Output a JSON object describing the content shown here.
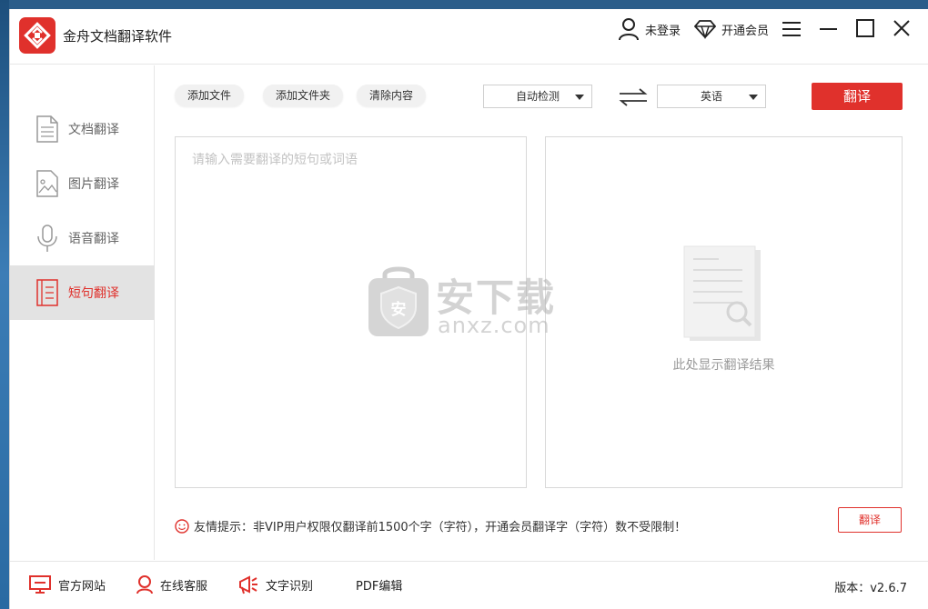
{
  "app": {
    "title": "金舟文档翻译软件"
  },
  "titlebar": {
    "login_label": "未登录",
    "vip_label": "开通会员"
  },
  "sidebar": {
    "items": [
      {
        "label": "文档翻译",
        "icon": "document-icon"
      },
      {
        "label": "图片翻译",
        "icon": "image-icon"
      },
      {
        "label": "语音翻译",
        "icon": "microphone-icon"
      },
      {
        "label": "短句翻译",
        "icon": "sentence-icon",
        "active": true
      }
    ]
  },
  "toolbar": {
    "add_file": "添加文件",
    "add_folder": "添加文件夹",
    "clear": "清除内容",
    "source_lang": "自动检测",
    "target_lang": "英语",
    "translate": "翻译"
  },
  "source": {
    "placeholder": "请输入需要翻译的短句或词语",
    "value": ""
  },
  "result": {
    "empty_text": "此处显示翻译结果"
  },
  "watermark": {
    "text": "安下载",
    "sub": "anxz.com",
    "badge": "安"
  },
  "tip": {
    "text": "友情提示：非VIP用户权限仅翻译前1500个字（字符），开通会员翻译字（字符）数不受限制！"
  },
  "bottom_translate": "翻译",
  "footer": {
    "website": "官方网站",
    "service": "在线客服",
    "ocr": "文字识别",
    "pdf": "PDF编辑",
    "version": "版本：v2.6.7"
  },
  "colors": {
    "accent": "#e0312c",
    "active_bg": "#e3e3e3"
  }
}
